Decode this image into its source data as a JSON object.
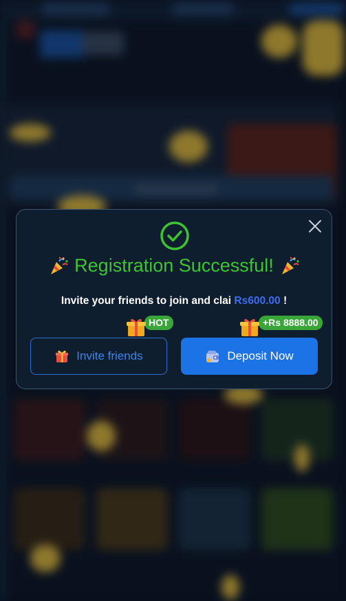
{
  "modal": {
    "title": "Registration Successful!",
    "invite_prefix": "Invite your friends to join and clai",
    "invite_amount": "Rs600.00",
    "invite_suffix": " !",
    "hot_badge": "HOT",
    "bonus_badge": "+Rs 8888.00",
    "invite_button": "Invite friends",
    "deposit_button": "Deposit Now"
  },
  "colors": {
    "success_green": "#3ec433",
    "amount_blue": "#3c6cf2",
    "deposit_blue": "#1c73e6",
    "badge_green": "#3aa63a",
    "modal_bg": "#0f1e2e"
  },
  "icons": {
    "close": "close-icon",
    "success": "check-circle-icon",
    "celebrate": "party-popper-icon",
    "gift": "gift-icon",
    "wallet": "wallet-icon"
  }
}
